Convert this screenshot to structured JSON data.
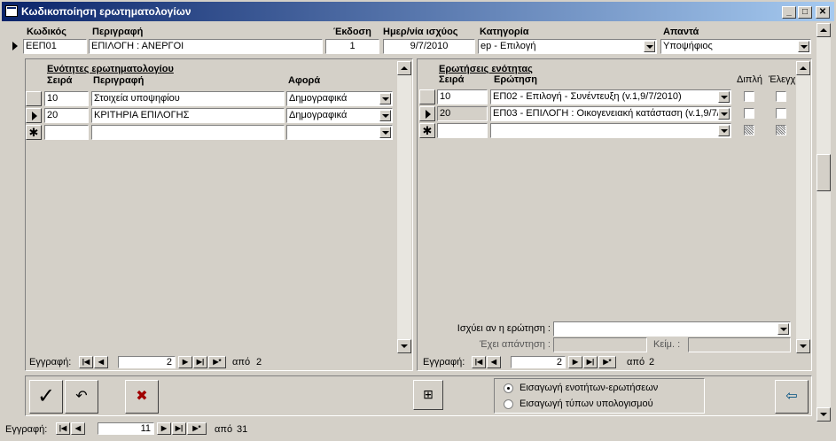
{
  "window": {
    "title": "Κωδικοποίηση ερωτηματολογίων",
    "min": "_",
    "max": "□",
    "close": "✕"
  },
  "header": {
    "labels": {
      "code": "Κωδικός",
      "desc": "Περιγραφή",
      "version": "Έκδοση",
      "date": "Ημερ/νία ισχύος",
      "category": "Κατηγορία",
      "answers": "Απαντά"
    },
    "values": {
      "code": "ΕΕΠ01",
      "desc": "ΕΠΙΛΟΓΗ : ΑΝΕΡΓΟΙ",
      "version": "1",
      "date": "9/7/2010",
      "category": "ep - Επιλογή",
      "answers": "Υποψήφιος"
    }
  },
  "sections": {
    "title": "Ενότητες ερωτηματολογίου",
    "cols": {
      "order": "Σειρά",
      "desc": "Περιγραφή",
      "about": "Αφορά"
    },
    "rows": [
      {
        "order": "10",
        "desc": "Στοιχεία υποψηφίου",
        "about": "Δημογραφικά"
      },
      {
        "order": "20",
        "desc": "ΚΡΙΤΗΡΙΑ ΕΠΙΛΟΓΗΣ",
        "about": "Δημογραφικά"
      }
    ],
    "nav": {
      "label": "Εγγραφή:",
      "current": "2",
      "of": "από",
      "total": "2"
    }
  },
  "questions": {
    "title": "Ερωτήσεις ενότητας",
    "cols": {
      "order": "Σειρά",
      "question": "Ερώτηση",
      "double": "Διπλή",
      "check": "Έλεγχ"
    },
    "rows": [
      {
        "order": "10",
        "question": "ΕΠ02 - Επιλογή - Συνέντευξη (v.1,9/7/2010)"
      },
      {
        "order": "20",
        "question": "ΕΠ03 - ΕΠΙΛΟΓΗ : Οικογενειακή κατάσταση (v.1,9/7/"
      }
    ],
    "valid_if_label": "Ισχύει αν η ερώτηση :",
    "has_answer_label": "Έχει απάντηση :",
    "text_label": "Κείμ. :",
    "nav": {
      "label": "Εγγραφή:",
      "current": "2",
      "of": "από",
      "total": "2"
    }
  },
  "options": {
    "radio1": "Εισαγωγή ενοτήτων-ερωτήσεων",
    "radio2": "Εισαγωγή τύπων υπολογισμού",
    "selected": "radio1"
  },
  "main_nav": {
    "label": "Εγγραφή:",
    "current": "11",
    "of": "από",
    "total": "31"
  },
  "nav_glyphs": {
    "first": "|◀",
    "prev": "◀",
    "next": "▶",
    "last": "▶|",
    "new": "▶*"
  }
}
